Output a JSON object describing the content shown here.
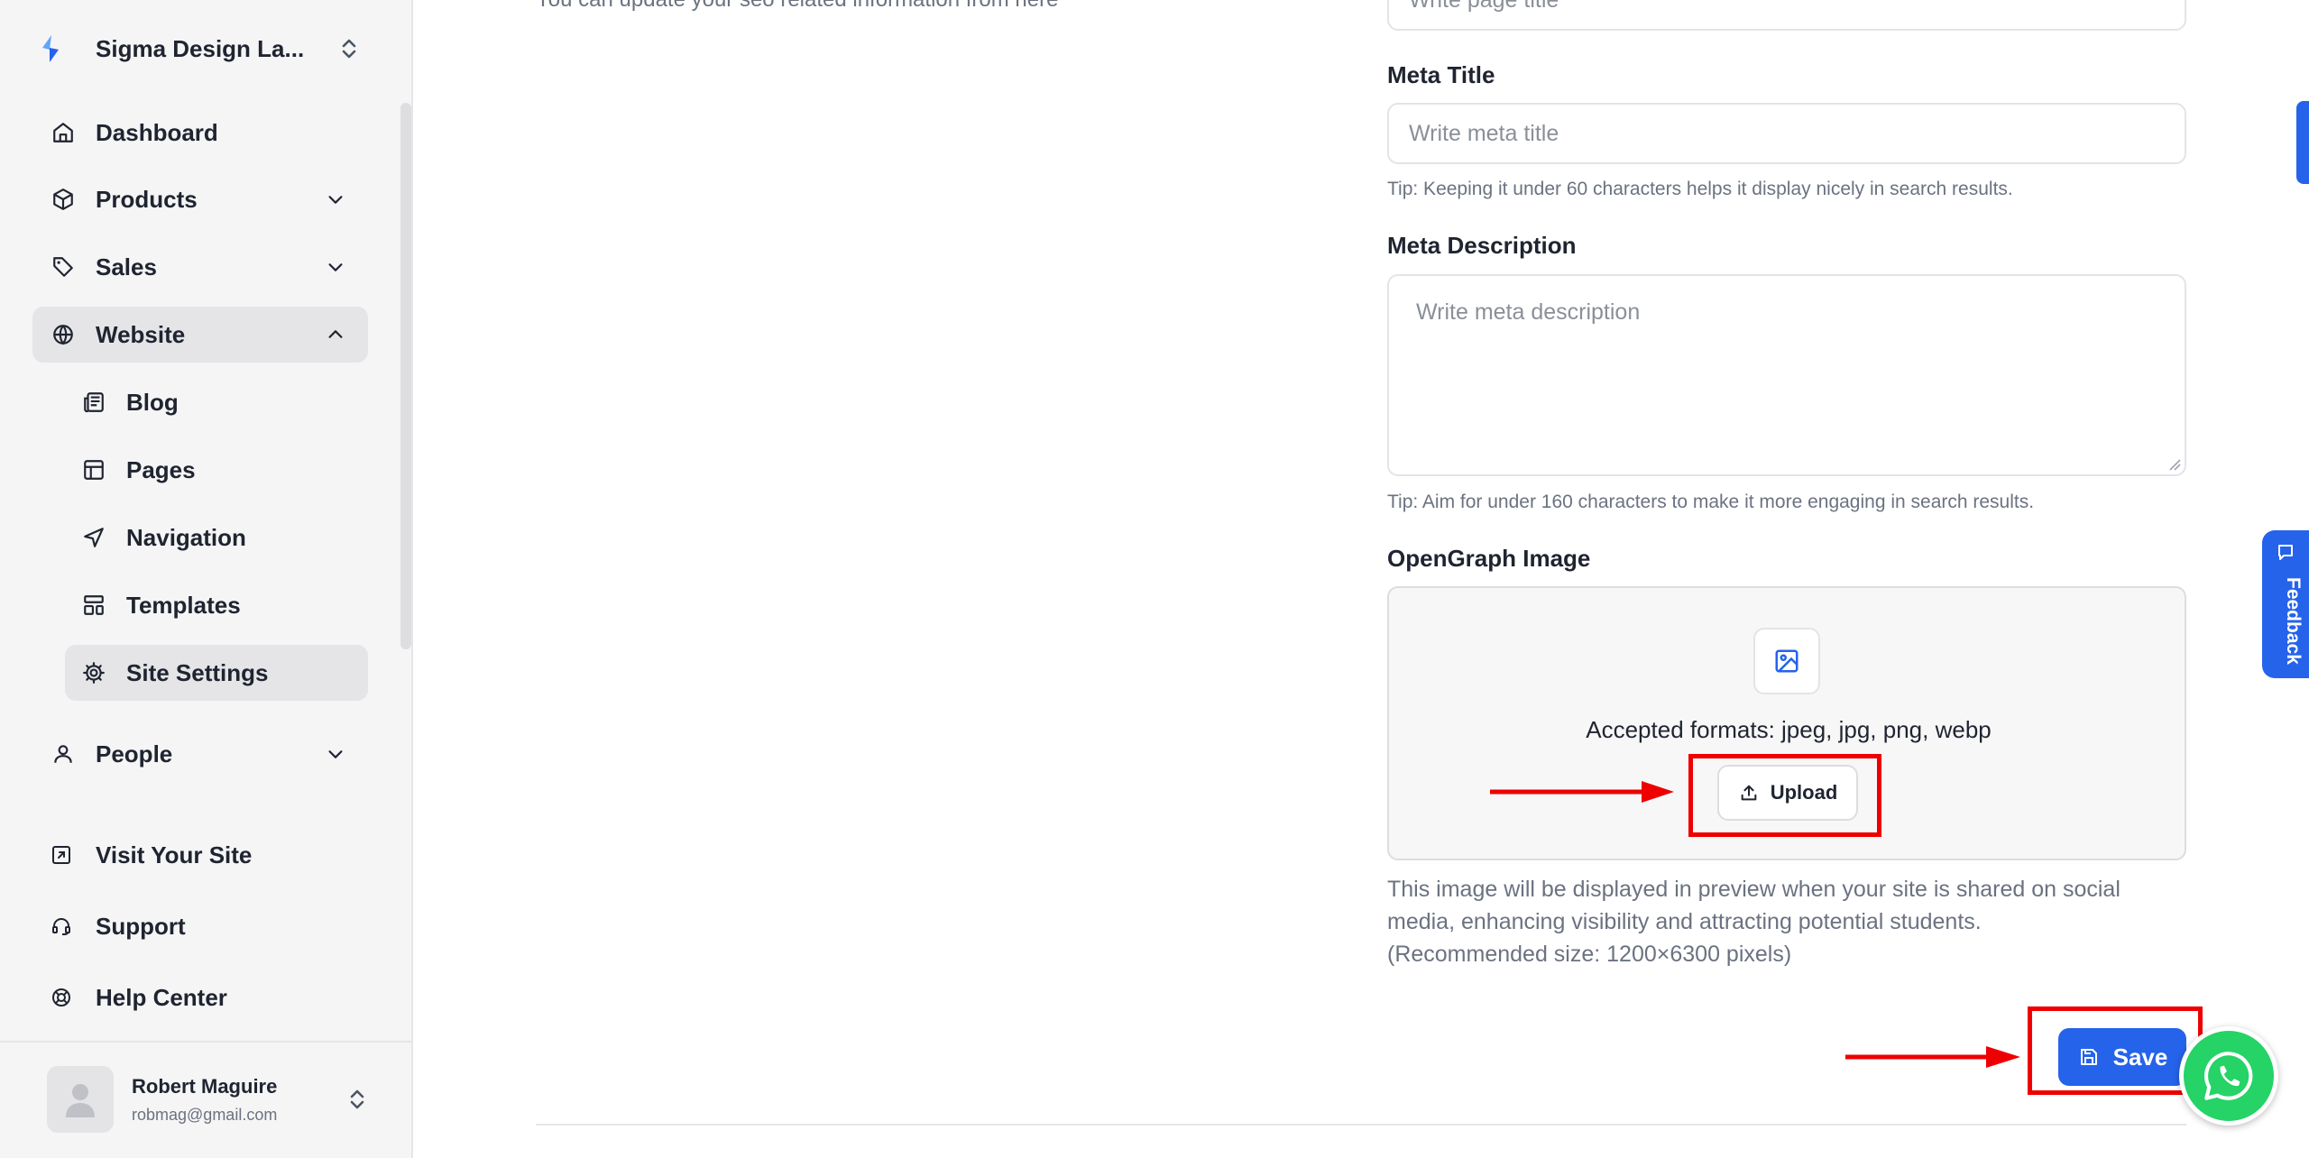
{
  "sidebar": {
    "org_name": "Sigma Design La...",
    "nav": {
      "dashboard": "Dashboard",
      "products": "Products",
      "sales": "Sales",
      "website": "Website",
      "people": "People"
    },
    "website_sub": {
      "blog": "Blog",
      "pages": "Pages",
      "navigation": "Navigation",
      "templates": "Templates",
      "site_settings": "Site Settings"
    },
    "bottom": {
      "visit_site": "Visit Your Site",
      "support": "Support",
      "help_center": "Help Center"
    },
    "user": {
      "name": "Robert Maguire",
      "email": "robmag@gmail.com"
    }
  },
  "seo": {
    "description": "You can update your seo related information from here",
    "page_title_placeholder": "Write page title",
    "meta_title_label": "Meta Title",
    "meta_title_placeholder": "Write meta title",
    "meta_title_tip": "Tip: Keeping it under 60 characters helps it display nicely in search results.",
    "meta_description_label": "Meta Description",
    "meta_description_placeholder": "Write meta description",
    "meta_description_tip": "Tip: Aim for under 160 characters to make it more engaging in search results.",
    "og_label": "OpenGraph Image",
    "og_formats": "Accepted formats: jpeg, jpg, png, webp",
    "upload_label": "Upload",
    "og_help_line1": "This image will be displayed in preview when your site is shared on social",
    "og_help_line2": "media, enhancing visibility and attracting potential students.",
    "og_help_line3": "(Recommended size: 1200×6300 pixels)",
    "save_label": "Save"
  },
  "feedback_label": "Feedback",
  "colors": {
    "accent": "#2563eb",
    "annotation": "#ee0000",
    "whatsapp": "#25d366"
  }
}
